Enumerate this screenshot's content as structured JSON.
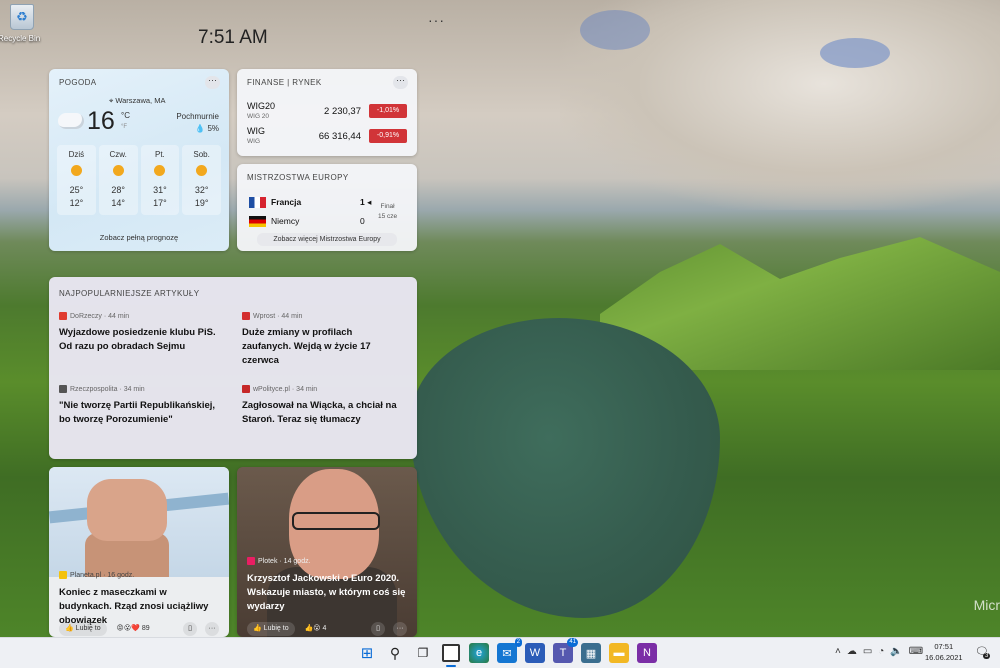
{
  "desktop": {
    "recycle_bin_label": "Recycle Bin"
  },
  "widgets_board": {
    "time": "7:51 AM",
    "more": "···"
  },
  "weather": {
    "title": "POGODA",
    "location": "Warszawa, MA",
    "temp": "16",
    "unit_c": "°C",
    "unit_f": "°F",
    "condition": "Pochmurnie",
    "precip": "5%",
    "days": [
      {
        "name": "Dziś",
        "hi": "25°",
        "lo": "12°"
      },
      {
        "name": "Czw.",
        "hi": "28°",
        "lo": "14°"
      },
      {
        "name": "Pt.",
        "hi": "31°",
        "lo": "17°"
      },
      {
        "name": "Sob.",
        "hi": "32°",
        "lo": "19°"
      }
    ],
    "forecast_link": "Zobacz pełną prognozę"
  },
  "finance": {
    "title": "FINANSE | RYNEK",
    "rows": [
      {
        "name": "WIG20",
        "sub": "WIG 20",
        "value": "2 230,37",
        "change": "-1,01%"
      },
      {
        "name": "WIG",
        "sub": "WIG",
        "value": "66 316,44",
        "change": "-0,91%"
      }
    ]
  },
  "euro": {
    "title": "MISTRZOSTWA EUROPY",
    "team1": "Francja",
    "score1": "1",
    "team2": "Niemcy",
    "score2": "0",
    "status_line1": "Finał",
    "status_line2": "15 cze",
    "link": "Zobacz więcej Mistrzostwa Europy"
  },
  "articles": {
    "title": "NAJPOPULARNIEJSZE ARTYKUŁY",
    "items": [
      {
        "source": "DoRzeczy · 44 min",
        "title": "Wyjazdowe posiedzenie klubu PiS. Od razu po obradach Sejmu"
      },
      {
        "source": "Wprost · 44 min",
        "title": "Duże zmiany w profilach zaufanych. Wejdą w życie 17 czerwca"
      },
      {
        "source": "Rzeczpospolita · 34 min",
        "title": "\"Nie tworzę Partii Republikańskiej, bo tworzę Porozumienie\""
      },
      {
        "source": "wPolityce.pl · 34 min",
        "title": "Zagłosował na Wiącka, a chciał na Staroń. Teraz się tłumaczy"
      }
    ]
  },
  "photo_cards": [
    {
      "source": "Planeta.pl · 16 godz.",
      "title": "Koniec z maseczkami w budynkach. Rząd znosi uciążliwy obowiązek",
      "like": "Lubię to",
      "reactions": "89"
    },
    {
      "source": "Plotek · 14 godz.",
      "title": "Krzysztof Jackowski o Euro 2020. Wskazuje miasto, w którym coś się wydarzy",
      "like": "Lubię to",
      "reactions": "4"
    }
  ],
  "taskbar": {
    "time": "07:51",
    "date": "16.06.2021",
    "mail_badge": "2",
    "teams_badge": "41",
    "notif_count": "3"
  },
  "watermark": "Micr"
}
